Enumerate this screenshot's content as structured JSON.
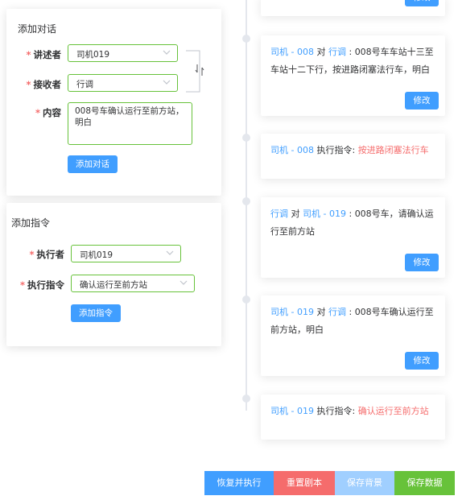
{
  "add_dialog": {
    "title": "添加对话",
    "narrator_label": "讲述者",
    "narrator_value": "司机019",
    "receiver_label": "接收者",
    "receiver_value": "行调",
    "content_label": "内容",
    "content_value": "008号车确认运行至前方站，明白",
    "submit_label": "添加对话",
    "swap_icon": "swap-icon"
  },
  "add_command": {
    "title": "添加指令",
    "executor_label": "执行者",
    "executor_value": "司机019",
    "command_label": "执行指令",
    "command_value": "确认运行至前方站",
    "submit_label": "添加指令"
  },
  "timeline": {
    "edit_label": "修改",
    "items": [
      {
        "type": "dialog",
        "speaker": "司机 - 008",
        "connector": "对",
        "receiver": "行调",
        "sep": ":",
        "message": "008号车车站十三至车站十二下行，按进路闭塞法行车，明白"
      },
      {
        "type": "command",
        "speaker": "司机 - 008",
        "prefix": "执行指令:",
        "command": "按进路闭塞法行车"
      },
      {
        "type": "dialog",
        "speaker": "行调",
        "connector": "对",
        "receiver": "司机 - 019",
        "sep": ":",
        "message": "008号车，请确认运行至前方站"
      },
      {
        "type": "dialog",
        "speaker": "司机 - 019",
        "connector": "对",
        "receiver": "行调",
        "sep": ":",
        "message": "008号车确认运行至前方站，明白"
      },
      {
        "type": "command",
        "speaker": "司机 - 019",
        "prefix": "执行指令:",
        "command": "确认运行至前方站"
      }
    ]
  },
  "bottom_bar": {
    "restore_label": "恢复并执行",
    "reset_label": "重置剧本",
    "save_bg_label": "保存背景",
    "save_data_label": "保存数据"
  },
  "colors": {
    "primary": "#409eff",
    "danger": "#f56c6c",
    "success": "#67c23a",
    "primary_light": "#a0cfff"
  }
}
